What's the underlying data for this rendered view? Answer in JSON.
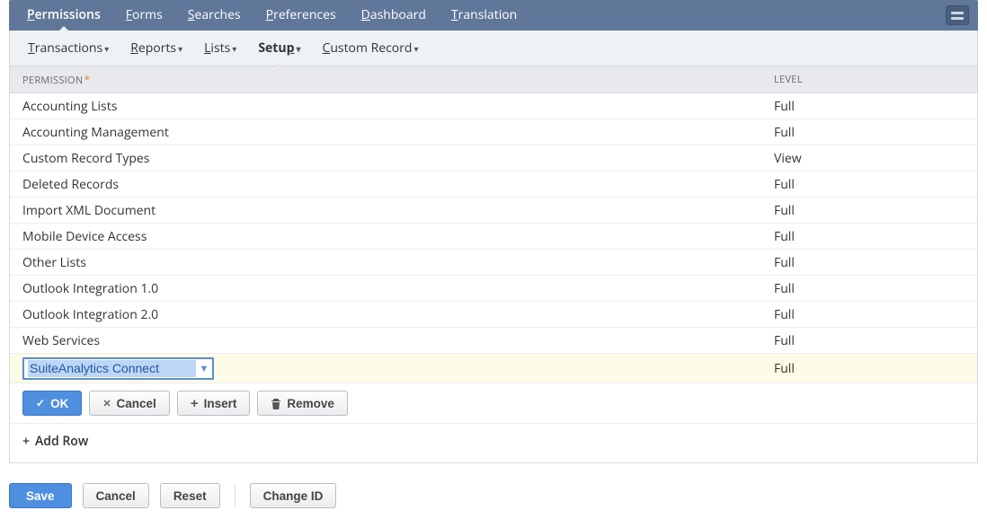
{
  "topnav": {
    "items": [
      {
        "prefix": "P",
        "rest": "ermissions",
        "active": true
      },
      {
        "prefix": "F",
        "rest": "orms"
      },
      {
        "prefix": "S",
        "rest": "earches"
      },
      {
        "prefix": "P",
        "rest": "references"
      },
      {
        "prefix": "D",
        "rest": "ashboard"
      },
      {
        "prefix": "T",
        "rest": "ranslation"
      }
    ]
  },
  "subtabs": {
    "items": [
      {
        "prefix": "T",
        "rest": "ransactions"
      },
      {
        "prefix": "R",
        "rest": "eports"
      },
      {
        "prefix": "L",
        "rest": "ists"
      },
      {
        "prefix": "Setu",
        "rest": "p",
        "ul_last": true,
        "active": true
      },
      {
        "prefix": "C",
        "rest": "ustom Record"
      }
    ]
  },
  "grid": {
    "headers": {
      "permission": "PERMISSION",
      "level": "LEVEL"
    },
    "rows": [
      {
        "permission": "Accounting Lists",
        "level": "Full"
      },
      {
        "permission": "Accounting Management",
        "level": "Full"
      },
      {
        "permission": "Custom Record Types",
        "level": "View"
      },
      {
        "permission": "Deleted Records",
        "level": "Full"
      },
      {
        "permission": "Import XML Document",
        "level": "Full"
      },
      {
        "permission": "Mobile Device Access",
        "level": "Full"
      },
      {
        "permission": "Other Lists",
        "level": "Full"
      },
      {
        "permission": "Outlook Integration 1.0",
        "level": "Full"
      },
      {
        "permission": "Outlook Integration 2.0",
        "level": "Full"
      },
      {
        "permission": "Web Services",
        "level": "Full"
      }
    ],
    "edit_row": {
      "permission": "SuiteAnalytics Connect",
      "level": "Full"
    }
  },
  "row_actions": {
    "ok": "OK",
    "cancel": "Cancel",
    "insert": "Insert",
    "remove": "Remove"
  },
  "add_row_label": "Add Row",
  "footer": {
    "save": "Save",
    "cancel": "Cancel",
    "reset": "Reset",
    "change_id": "Change ID"
  }
}
